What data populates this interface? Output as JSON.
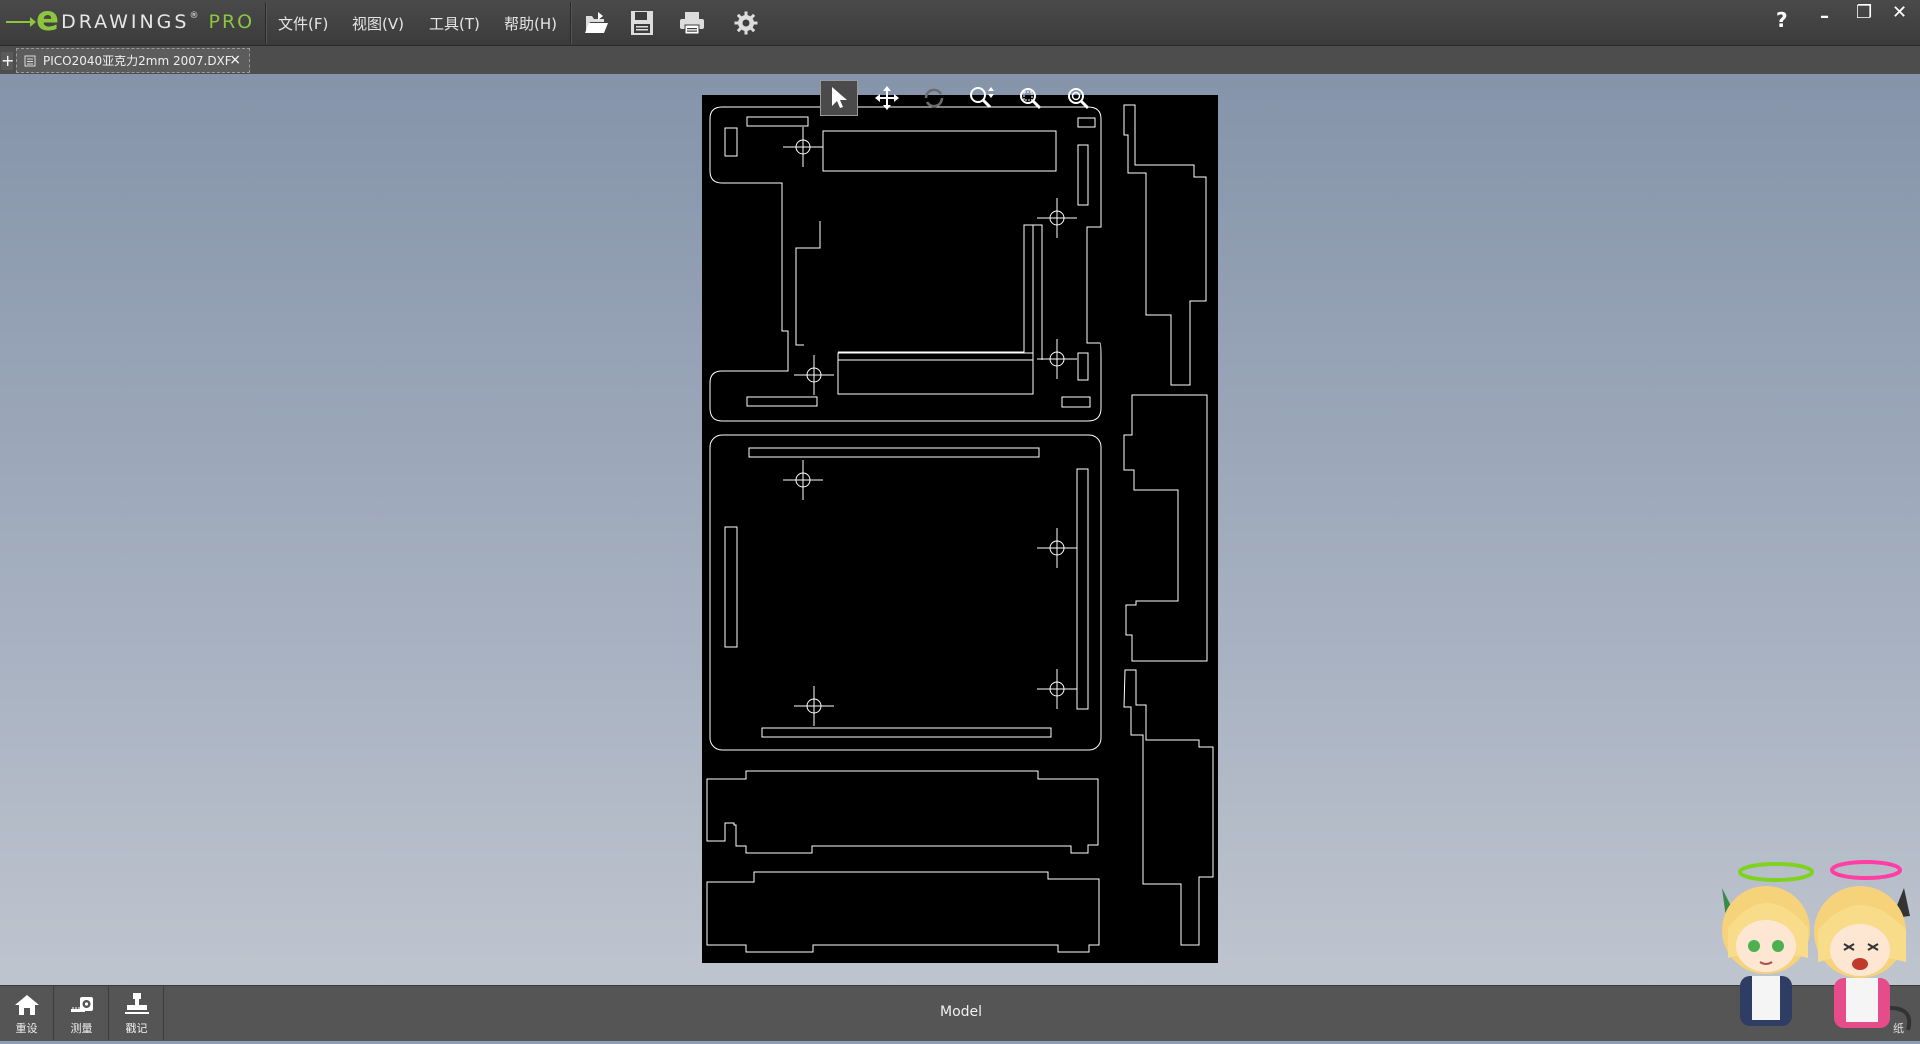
{
  "app": {
    "logo_e": "e",
    "logo_word": "DRAWINGS",
    "logo_registered": "®",
    "logo_pro": "PRO"
  },
  "menu": {
    "file": "文件(F)",
    "view": "视图(V)",
    "tools": "工具(T)",
    "help": "帮助(H)"
  },
  "toolbar": {
    "open_icon": "open-folder-icon",
    "save_icon": "save-icon",
    "print_icon": "print-icon",
    "settings_icon": "gear-icon"
  },
  "window_controls": {
    "help": "?",
    "minimize": "–",
    "restore": "❐",
    "close": "✕"
  },
  "tabs": {
    "add": "+",
    "active": {
      "label": "PICO2040亚克力2mm 2007.DXF",
      "close": "×"
    }
  },
  "view_tools": [
    {
      "name": "select",
      "icon": "cursor-icon",
      "active": true
    },
    {
      "name": "pan",
      "icon": "move-icon",
      "active": false
    },
    {
      "name": "rotate",
      "icon": "rotate-icon",
      "active": false,
      "disabled": true
    },
    {
      "name": "zoom",
      "icon": "zoom-icon",
      "active": false
    },
    {
      "name": "zoom-area",
      "icon": "zoom-area-icon",
      "active": false
    },
    {
      "name": "zoom-fit",
      "icon": "zoom-fit-icon",
      "active": false
    }
  ],
  "bottom": {
    "buttons": [
      {
        "label": "重设",
        "icon": "home-icon"
      },
      {
        "label": "测量",
        "icon": "measure-icon"
      },
      {
        "label": "戳记",
        "icon": "stamp-icon"
      }
    ],
    "model_label": "Model",
    "corner_label": "纸"
  },
  "colors": {
    "accent": "#8cc63f",
    "sheet": "#000000",
    "outline": "#ffffff"
  }
}
